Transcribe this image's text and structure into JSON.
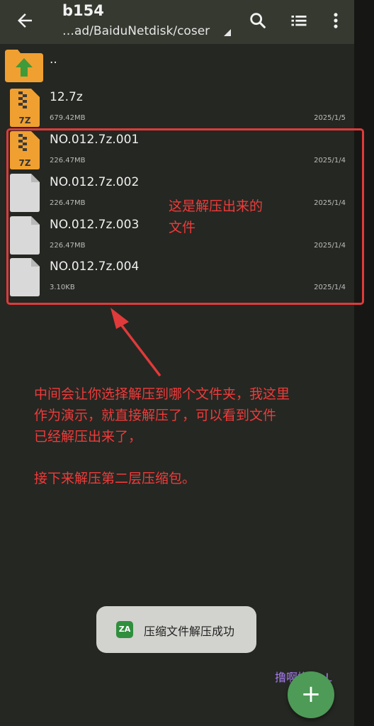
{
  "appbar": {
    "title": "b154",
    "path": "…ad/BaiduNetdisk/coser",
    "icons": [
      "back-arrow-icon",
      "search-icon",
      "list-view-icon",
      "more-vert-icon"
    ]
  },
  "parent": {
    "label": ".."
  },
  "files": [
    {
      "name": "12.7z",
      "size": "679.42MB",
      "date": "2025/1/5",
      "icon": "7z-archive-icon"
    },
    {
      "name": "NO.012.7z.001",
      "size": "226.47MB",
      "date": "2025/1/4",
      "icon": "7z-archive-icon"
    },
    {
      "name": "NO.012.7z.002",
      "size": "226.47MB",
      "date": "2025/1/4",
      "icon": "generic-file-icon"
    },
    {
      "name": "NO.012.7z.003",
      "size": "226.47MB",
      "date": "2025/1/4",
      "icon": "generic-file-icon"
    },
    {
      "name": "NO.012.7z.004",
      "size": "3.10KB",
      "date": "2025/1/4",
      "icon": "generic-file-icon"
    }
  ],
  "annotations": {
    "note1_line1": "这是解压出来的",
    "note1_line2": "文件",
    "note2_line1": "中间会让你选择解压到哪个文件夹，我这里",
    "note2_line2": "作为演示，就直接解压了，可以看到文件",
    "note2_line3": "已经解压出来了，",
    "note3": "接下来解压第二层压缩包。"
  },
  "toast": {
    "icon_text": "ZA",
    "text": "压缩文件解压成功"
  },
  "watermark": "撸啊撸 LoL",
  "fab": {
    "label": "+"
  },
  "colors": {
    "appbar": "#363930",
    "background": "#252722",
    "annotation_red": "#ee3b3b",
    "fab": "#4e9a57",
    "archive_orange": "#f0a030"
  }
}
